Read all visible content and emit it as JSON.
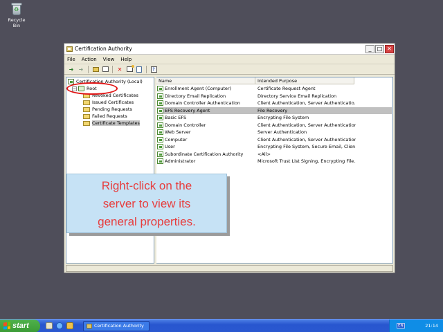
{
  "desktop": {
    "recycle_bin_label": "Recycle Bin"
  },
  "window": {
    "title": "Certification Authority",
    "controls": {
      "minimize": "_",
      "maximize": "□",
      "close": "✕"
    },
    "menu": [
      "File",
      "Action",
      "View",
      "Help"
    ],
    "toolbar_icons": [
      "back-arrow-icon",
      "forward-arrow-icon",
      "up-folder-icon",
      "console-tree-icon",
      "delete-icon",
      "properties-icon",
      "export-icon",
      "help-icon"
    ]
  },
  "tree": {
    "root_label": "Certification Authority (Local)",
    "server_label": "Root",
    "folders": [
      "Revoked Certificates",
      "Issued Certificates",
      "Pending Requests",
      "Failed Requests",
      "Certificate Templates"
    ]
  },
  "list": {
    "columns": {
      "name": "Name",
      "purpose": "Intended Purpose"
    },
    "rows": [
      {
        "name": "Enrollment Agent (Computer)",
        "purpose": "Certificate Request Agent"
      },
      {
        "name": "Directory Email Replication",
        "purpose": "Directory Service Email Replication"
      },
      {
        "name": "Domain Controller Authentication",
        "purpose": "Client Authentication, Server Authenticatio..."
      },
      {
        "name": "EFS Recovery Agent",
        "purpose": "File Recovery"
      },
      {
        "name": "Basic EFS",
        "purpose": "Encrypting File System"
      },
      {
        "name": "Domain Controller",
        "purpose": "Client Authentication, Server Authentication"
      },
      {
        "name": "Web Server",
        "purpose": "Server Authentication"
      },
      {
        "name": "Computer",
        "purpose": "Client Authentication, Server Authentication"
      },
      {
        "name": "User",
        "purpose": "Encrypting File System, Secure Email, Clien..."
      },
      {
        "name": "Subordinate Certification Authority",
        "purpose": "<All>"
      },
      {
        "name": "Administrator",
        "purpose": "Microsoft Trust List Signing, Encrypting File..."
      }
    ]
  },
  "callout": {
    "line1": "Right-click on the",
    "line2": "server to view its",
    "line3": "general properties."
  },
  "taskbar": {
    "start_label": "start",
    "task_button_label": "Certification Authority",
    "language": "EN",
    "clock": "21:14"
  },
  "colors": {
    "desktop": "#4f4e5a",
    "callout_bg": "#c6e2f5",
    "callout_text": "#e73d3d",
    "highlight_circle": "#e01414",
    "taskbar": "#2856cf"
  }
}
